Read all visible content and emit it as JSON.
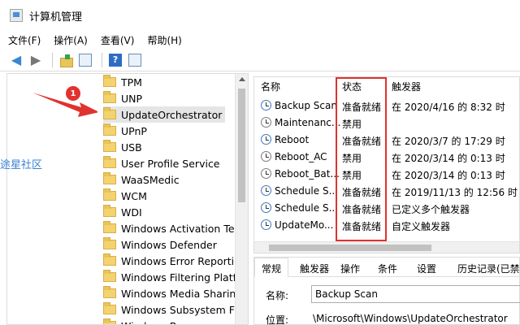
{
  "window": {
    "title": "计算机管理"
  },
  "menu": [
    "文件(F)",
    "操作(A)",
    "查看(V)",
    "帮助(H)"
  ],
  "toolbar": {
    "help_label": "?"
  },
  "tree": {
    "items": [
      {
        "label": "TPM",
        "selected": false
      },
      {
        "label": "UNP",
        "selected": false
      },
      {
        "label": "UpdateOrchestrator",
        "selected": true
      },
      {
        "label": "UPnP",
        "selected": false
      },
      {
        "label": "USB",
        "selected": false
      },
      {
        "label": "User Profile Service",
        "selected": false
      },
      {
        "label": "WaaSMedic",
        "selected": false
      },
      {
        "label": "WCM",
        "selected": false
      },
      {
        "label": "WDI",
        "selected": false
      },
      {
        "label": "Windows Activation Tec",
        "selected": false
      },
      {
        "label": "Windows Defender",
        "selected": false
      },
      {
        "label": "Windows Error Reportir",
        "selected": false
      },
      {
        "label": "Windows Filtering Platfc",
        "selected": false
      },
      {
        "label": "Windows Media Sharing",
        "selected": false
      },
      {
        "label": "Windows Subsystem Fo",
        "selected": false
      },
      {
        "label": "Windows Ba",
        "selected": false
      }
    ]
  },
  "watermark": "途星社区",
  "annotation": {
    "badge": "1",
    "accent_color": "#e0322e"
  },
  "tasks": {
    "columns": {
      "name": "名称",
      "status": "状态",
      "trigger": "触发器"
    },
    "rows": [
      {
        "name": "Backup Scan",
        "status": "准备就绪",
        "trigger": "在 2020/4/16 的 8:32 时"
      },
      {
        "name": "Maintenanc...",
        "status": "禁用",
        "trigger": ""
      },
      {
        "name": "Reboot",
        "status": "准备就绪",
        "trigger": "在 2020/3/7 的 17:29 时"
      },
      {
        "name": "Reboot_AC",
        "status": "禁用",
        "trigger": "在 2020/3/14 的 0:13 时"
      },
      {
        "name": "Reboot_Bat...",
        "status": "禁用",
        "trigger": "在 2020/3/14 的 0:13 时"
      },
      {
        "name": "Schedule S...",
        "status": "准备就绪",
        "trigger": "在 2019/11/13 的 12:56 时 -"
      },
      {
        "name": "Schedule S...",
        "status": "准备就绪",
        "trigger": "已定义多个触发器"
      },
      {
        "name": "UpdateMo...",
        "status": "准备就绪",
        "trigger": "自定义触发器"
      }
    ]
  },
  "details": {
    "tabs": [
      "常规",
      "触发器",
      "操作",
      "条件",
      "设置",
      "历史记录(已禁"
    ],
    "name_label": "名称:",
    "name_value": "Backup Scan",
    "location_label": "位置:",
    "location_value": "\\Microsoft\\Windows\\UpdateOrchestrator"
  }
}
